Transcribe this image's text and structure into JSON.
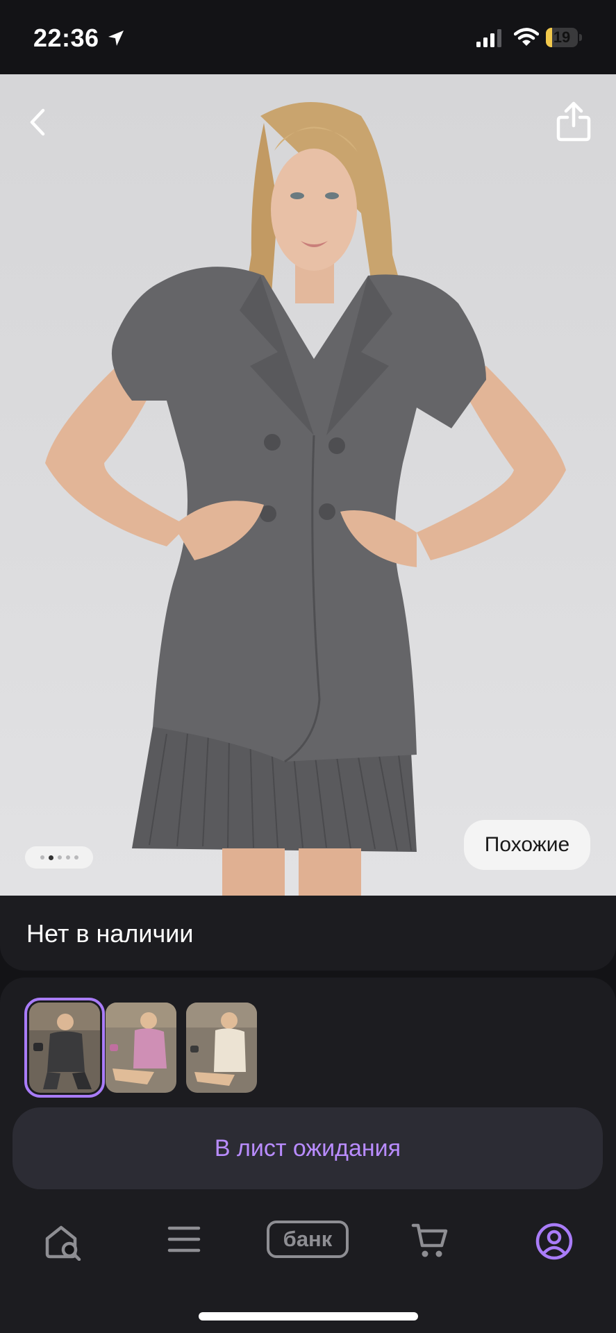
{
  "status_bar": {
    "time": "22:36",
    "battery_level": "19",
    "battery_fraction": 0.19,
    "icons": [
      "location-arrow-icon",
      "cellular-signal-icon",
      "wifi-icon",
      "battery-icon"
    ]
  },
  "product": {
    "gallery": {
      "image_description": "grey short-sleeve blazer dress with pleated skirt worn by a model",
      "page_count": 5,
      "active_page": 2,
      "similar_button": "Похожие"
    },
    "availability": "Нет в наличии",
    "variants": [
      {
        "color": "grey",
        "selected": true
      },
      {
        "color": "pink",
        "selected": false
      },
      {
        "color": "cream",
        "selected": false
      }
    ],
    "waitlist_button": "В лист ожидания"
  },
  "tab_bar": {
    "items": [
      "home-search-icon",
      "menu-icon",
      "bank-icon",
      "cart-icon",
      "profile-icon"
    ],
    "bank_label": "банк",
    "active": "profile",
    "accent_color": "#a97cf8"
  },
  "colors": {
    "background": "#131316",
    "card": "#1c1c20",
    "button": "#2c2c34",
    "accent_text": "#b98cff"
  }
}
